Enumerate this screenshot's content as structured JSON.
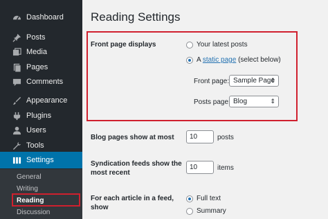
{
  "sidebar": {
    "items": [
      {
        "label": "Dashboard",
        "icon": "dashboard-icon"
      },
      {
        "label": "Posts",
        "icon": "pin-icon"
      },
      {
        "label": "Media",
        "icon": "media-icon"
      },
      {
        "label": "Pages",
        "icon": "pages-icon"
      },
      {
        "label": "Comments",
        "icon": "comments-icon"
      },
      {
        "label": "Appearance",
        "icon": "appearance-icon"
      },
      {
        "label": "Plugins",
        "icon": "plugins-icon"
      },
      {
        "label": "Users",
        "icon": "users-icon"
      },
      {
        "label": "Tools",
        "icon": "tools-icon"
      },
      {
        "label": "Settings",
        "icon": "settings-icon"
      }
    ],
    "submenu": [
      "General",
      "Writing",
      "Reading",
      "Discussion"
    ]
  },
  "main": {
    "title": "Reading Settings",
    "front_page": {
      "label": "Front page displays",
      "option_latest": "Your latest posts",
      "option_static_prefix": "A",
      "option_static_link": "static page",
      "option_static_suffix": "(select below)",
      "front_page_label": "Front page:",
      "front_page_value": "Sample Page",
      "posts_page_label": "Posts page:",
      "posts_page_value": "Blog"
    },
    "blog_pages": {
      "label": "Blog pages show at most",
      "value": "10",
      "unit": "posts"
    },
    "syndication": {
      "label_line1": "Syndication feeds show the",
      "label_line2": "most recent",
      "value": "10",
      "unit": "items"
    },
    "feed": {
      "label_line1": "For each article in a feed,",
      "label_line2": "show",
      "option_full": "Full text",
      "option_summary": "Summary"
    }
  },
  "colors": {
    "accent": "#0073aa",
    "highlight": "#d0202e",
    "sidebar": "#23282d"
  }
}
